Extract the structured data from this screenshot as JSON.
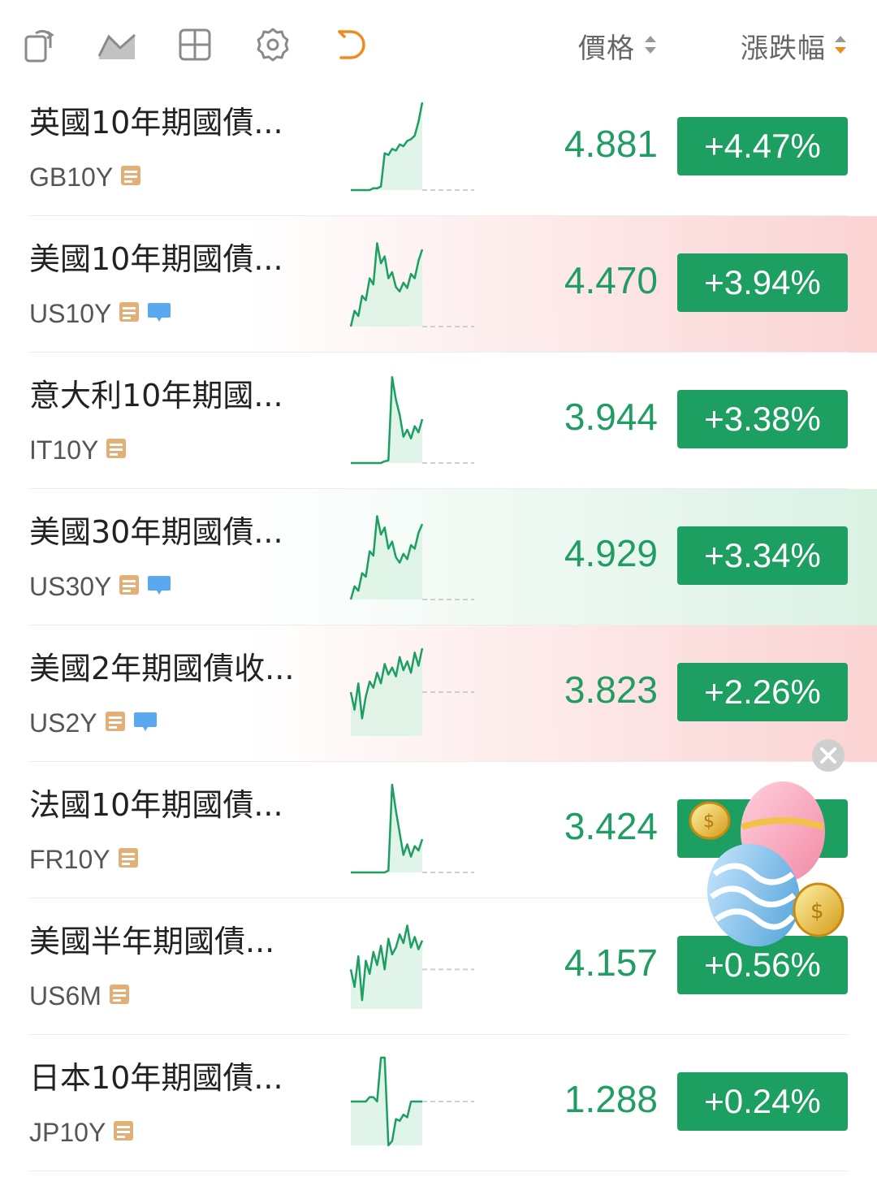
{
  "header": {
    "price_label": "價格",
    "change_label": "漲跌幅",
    "icons": [
      "copy-rotate-icon",
      "area-chart-icon",
      "grid-icon",
      "settings-icon",
      "undo-icon"
    ]
  },
  "colors": {
    "up_green": "#1c9f61",
    "price_green": "#1f9d63",
    "flash_red": "#fbd3d3",
    "flash_green": "#daf1e4",
    "active_orange": "#f08a1d"
  },
  "rows": [
    {
      "name": "英國10年期國債...",
      "code": "GB10Y",
      "price": "4.881",
      "change": "+4.47%",
      "badges": [
        "note"
      ],
      "flash": "none",
      "spark": [
        0.0,
        0.0,
        0.0,
        0.0,
        0.0,
        0.0,
        0.02,
        0.02,
        0.04,
        0.42,
        0.4,
        0.47,
        0.45,
        0.52,
        0.5,
        0.56,
        0.58,
        0.62,
        0.78,
        1.0
      ]
    },
    {
      "name": "美國10年期國債...",
      "code": "US10Y",
      "price": "4.470",
      "change": "+3.94%",
      "badges": [
        "note",
        "chat"
      ],
      "flash": "red",
      "spark": [
        0.0,
        0.18,
        0.12,
        0.35,
        0.3,
        0.55,
        0.48,
        0.95,
        0.72,
        0.8,
        0.55,
        0.62,
        0.45,
        0.4,
        0.5,
        0.44,
        0.6,
        0.55,
        0.75,
        0.88
      ]
    },
    {
      "name": "意大利10年期國...",
      "code": "IT10Y",
      "price": "3.944",
      "change": "+3.38%",
      "badges": [
        "note"
      ],
      "flash": "none",
      "spark": [
        0.0,
        0.0,
        0.0,
        0.0,
        0.0,
        0.0,
        0.0,
        0.0,
        0.0,
        0.02,
        0.03,
        0.98,
        0.72,
        0.55,
        0.3,
        0.38,
        0.28,
        0.42,
        0.35,
        0.5
      ]
    },
    {
      "name": "美國30年期國債...",
      "code": "US30Y",
      "price": "4.929",
      "change": "+3.34%",
      "badges": [
        "note",
        "chat"
      ],
      "flash": "green",
      "spark": [
        0.0,
        0.15,
        0.1,
        0.3,
        0.26,
        0.55,
        0.5,
        0.95,
        0.74,
        0.82,
        0.58,
        0.66,
        0.48,
        0.42,
        0.52,
        0.46,
        0.62,
        0.58,
        0.76,
        0.86
      ]
    },
    {
      "name": "美國2年期國債收...",
      "code": "US2Y",
      "price": "3.823",
      "change": "+2.26%",
      "badges": [
        "note",
        "chat"
      ],
      "flash": "red",
      "spark": [
        0.5,
        0.3,
        0.6,
        0.2,
        0.45,
        0.62,
        0.55,
        0.72,
        0.6,
        0.82,
        0.7,
        0.78,
        0.68,
        0.9,
        0.75,
        0.85,
        0.72,
        0.95,
        0.8,
        1.0
      ]
    },
    {
      "name": "法國10年期國債...",
      "code": "FR10Y",
      "price": "3.424",
      "change": "+1",
      "badges": [
        "note"
      ],
      "flash": "none",
      "spark": [
        0.0,
        0.0,
        0.0,
        0.0,
        0.0,
        0.0,
        0.0,
        0.0,
        0.0,
        0.0,
        0.02,
        1.0,
        0.7,
        0.45,
        0.2,
        0.32,
        0.18,
        0.3,
        0.25,
        0.38
      ]
    },
    {
      "name": "美國半年期國債...",
      "code": "US6M",
      "price": "4.157",
      "change": "+0.56%",
      "badges": [
        "note"
      ],
      "flash": "none",
      "spark": [
        0.45,
        0.25,
        0.6,
        0.1,
        0.55,
        0.4,
        0.65,
        0.5,
        0.72,
        0.45,
        0.8,
        0.62,
        0.7,
        0.85,
        0.75,
        0.95,
        0.7,
        0.82,
        0.68,
        0.78
      ]
    },
    {
      "name": "日本10年期國債...",
      "code": "JP10Y",
      "price": "1.288",
      "change": "+0.24%",
      "badges": [
        "note"
      ],
      "flash": "none",
      "spark": [
        0.5,
        0.5,
        0.5,
        0.5,
        0.5,
        0.55,
        0.55,
        0.5,
        1.0,
        1.0,
        0.0,
        0.05,
        0.3,
        0.28,
        0.35,
        0.32,
        0.5,
        0.5,
        0.5,
        0.5
      ]
    }
  ],
  "promo": {
    "icon": "easter-egg-coins-icon",
    "close_icon": "close-circle-icon"
  }
}
